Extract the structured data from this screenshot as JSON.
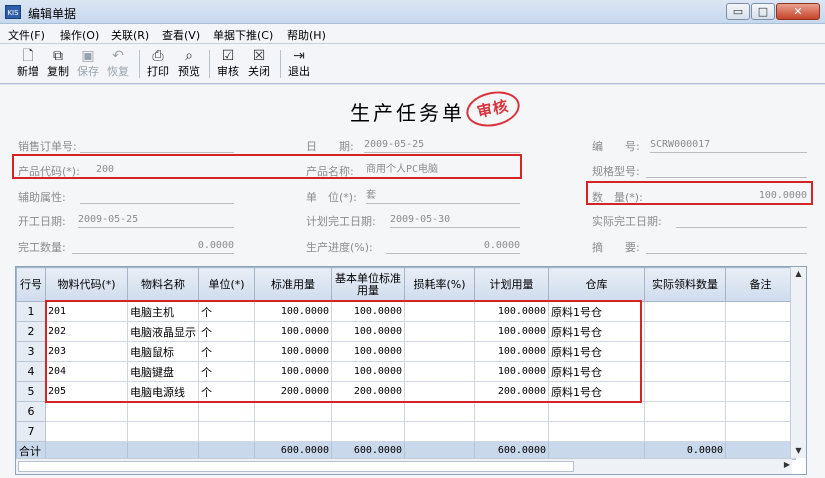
{
  "window": {
    "title": "编辑单据",
    "icon_text": "KIS",
    "min_symbol": "▭",
    "max_symbol": "□",
    "close_symbol": "✕"
  },
  "menu": [
    "文件(F)",
    "操作(O)",
    "关联(R)",
    "查看(V)",
    "单据下推(C)",
    "帮助(H)"
  ],
  "toolbar": {
    "new": {
      "label": "新增",
      "icon": "new-doc-icon",
      "glyph": "🗋"
    },
    "copy": {
      "label": "复制",
      "icon": "copy-icon",
      "glyph": "⧉"
    },
    "save": {
      "label": "保存",
      "icon": "save-icon",
      "glyph": "▣"
    },
    "restore": {
      "label": "恢复",
      "icon": "undo-icon",
      "glyph": "↶"
    },
    "print": {
      "label": "打印",
      "icon": "print-icon",
      "glyph": "⎙"
    },
    "preview": {
      "label": "预览",
      "icon": "preview-icon",
      "glyph": "⌕"
    },
    "audit": {
      "label": "审核",
      "icon": "audit-icon",
      "glyph": "☑"
    },
    "close": {
      "label": "关闭",
      "icon": "close-box-icon",
      "glyph": "☒"
    },
    "exit": {
      "label": "退出",
      "icon": "exit-icon",
      "glyph": "⇥"
    }
  },
  "doc": {
    "title": "生产任务单",
    "stamp": "审核"
  },
  "fields": {
    "sales_order": {
      "label": "销售订单号:",
      "value": ""
    },
    "date": {
      "label": "日　　期:",
      "value": "2009-05-25"
    },
    "number": {
      "label": "编　　号:",
      "value": "SCRW000017"
    },
    "product_code": {
      "label": "产品代码(*):",
      "value": "200"
    },
    "product_name": {
      "label": "产品名称:",
      "value": "商用个人PC电脑"
    },
    "spec": {
      "label": "规格型号:",
      "value": ""
    },
    "aux_attr": {
      "label": "辅助属性:",
      "value": ""
    },
    "unit": {
      "label": "单　位(*):",
      "value": "套"
    },
    "quantity": {
      "label": "数　量(*):",
      "value": "100.0000"
    },
    "start_date": {
      "label": "开工日期:",
      "value": "2009-05-25"
    },
    "plan_finish": {
      "label": "计划完工日期:",
      "value": "2009-05-30"
    },
    "actual_finish": {
      "label": "实际完工日期:",
      "value": ""
    },
    "done_qty": {
      "label": "完工数量:",
      "value": "0.0000"
    },
    "progress": {
      "label": "生产进度(%):",
      "value": "0.0000"
    },
    "summary": {
      "label": "摘　　要:",
      "value": ""
    }
  },
  "grid": {
    "headers": [
      "行号",
      "物料代码(*)",
      "物料名称",
      "单位(*)",
      "标准用量",
      "基本单位标准用量",
      "损耗率(%)",
      "计划用量",
      "仓库",
      "实际领料数量",
      "备注"
    ],
    "rows": [
      [
        "1",
        "201",
        "电脑主机",
        "个",
        "100.0000",
        "100.0000",
        "",
        "100.0000",
        "原料1号仓",
        "",
        ""
      ],
      [
        "2",
        "202",
        "电脑液晶显示",
        "个",
        "100.0000",
        "100.0000",
        "",
        "100.0000",
        "原料1号仓",
        "",
        ""
      ],
      [
        "3",
        "203",
        "电脑鼠标",
        "个",
        "100.0000",
        "100.0000",
        "",
        "100.0000",
        "原料1号仓",
        "",
        ""
      ],
      [
        "4",
        "204",
        "电脑键盘",
        "个",
        "100.0000",
        "100.0000",
        "",
        "100.0000",
        "原料1号仓",
        "",
        ""
      ],
      [
        "5",
        "205",
        "电脑电源线",
        "个",
        "200.0000",
        "200.0000",
        "",
        "200.0000",
        "原料1号仓",
        "",
        ""
      ],
      [
        "6",
        "",
        "",
        "",
        "",
        "",
        "",
        "",
        "",
        "",
        ""
      ],
      [
        "7",
        "",
        "",
        "",
        "",
        "",
        "",
        "",
        "",
        "",
        ""
      ]
    ],
    "total": [
      "合计",
      "",
      "",
      "",
      "600.0000",
      "600.0000",
      "",
      "600.0000",
      "",
      "0.0000",
      ""
    ]
  },
  "colors": {
    "highlight": "#d42424",
    "stamp": "#d8323b"
  }
}
